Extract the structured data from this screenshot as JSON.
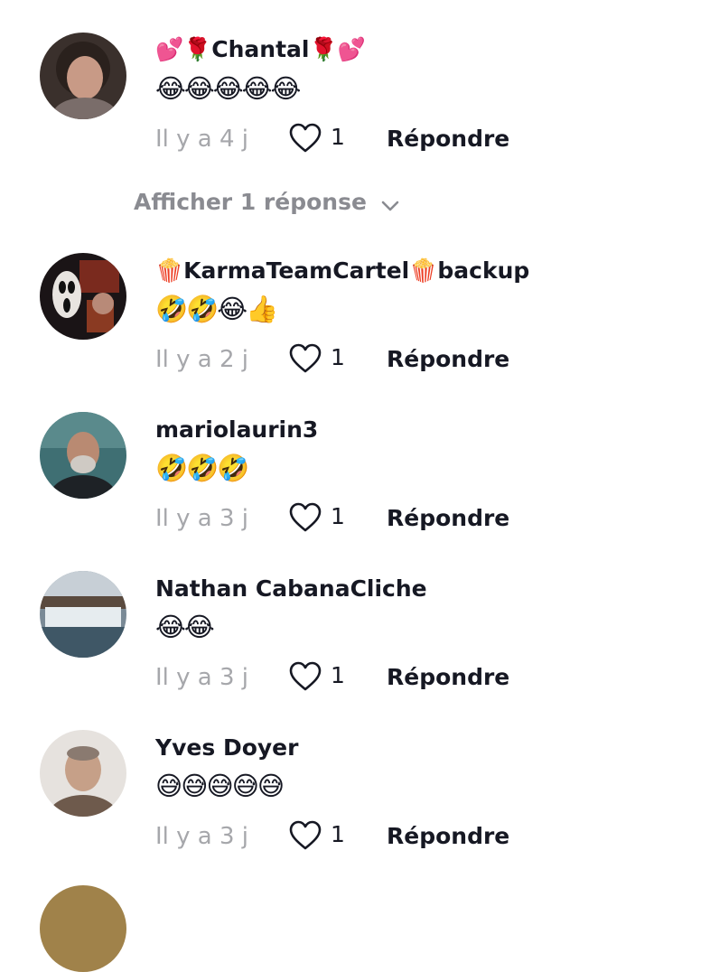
{
  "comments": [
    {
      "username": "💕🌹Chantal🌹💕",
      "text": "😂😂😂😂😂",
      "time": "Il y a 4 j",
      "likes": "1",
      "reply_label": "Répondre",
      "view_replies": "Afficher 1 réponse"
    },
    {
      "username": "🍿KarmaTeamCartel🍿backup",
      "text": "🤣🤣😂👍",
      "time": "Il y a 2 j",
      "likes": "1",
      "reply_label": "Répondre"
    },
    {
      "username": "mariolaurin3",
      "text": "🤣🤣🤣",
      "time": "Il y a 3 j",
      "likes": "1",
      "reply_label": "Répondre"
    },
    {
      "username": "Nathan CabanaCliche",
      "text": "😂😂",
      "time": "Il y a 3 j",
      "likes": "1",
      "reply_label": "Répondre"
    },
    {
      "username": "Yves Doyer",
      "text": "😅😅😅😅😅",
      "time": "Il y a 3 j",
      "likes": "1",
      "reply_label": "Répondre"
    }
  ],
  "icons": {
    "like": "heart-outline-icon",
    "expand": "chevron-down-icon"
  },
  "colors": {
    "primary_text": "#161823",
    "secondary_text": "#a6a7ab",
    "view_replies_text": "#8a8b91",
    "background": "#ffffff"
  }
}
